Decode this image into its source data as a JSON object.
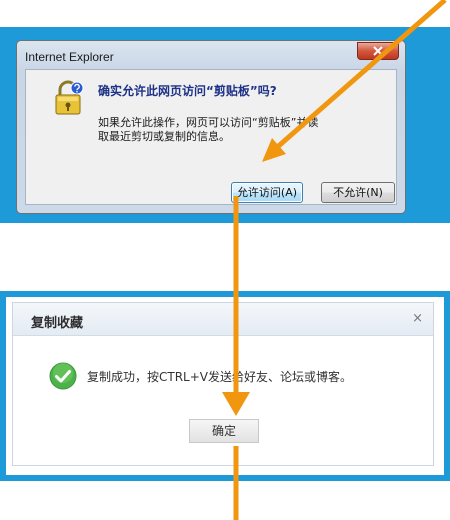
{
  "ie_dialog": {
    "window_title": "Internet Explorer",
    "close_symbol": "✕",
    "heading": "确实允许此网页访问“剪贴板”吗?",
    "description": "如果允许此操作，网页可以访问“剪贴板”并读取最近剪切或复制的信息。",
    "allow_button": "允许访问(A)",
    "deny_button": "不允许(N)"
  },
  "copy_dialog": {
    "title": "复制收藏",
    "close_symbol": "×",
    "message": "复制成功，按CTRL+V发送给好友、论坛或博客。",
    "ok_button": "确定"
  },
  "colors": {
    "annotation_frame": "#1e9ad9",
    "annotation_arrow": "#f0960f",
    "success_green": "#4cb34a"
  },
  "icons": {
    "lock": "padlock-question-icon",
    "success": "green-check-icon"
  }
}
